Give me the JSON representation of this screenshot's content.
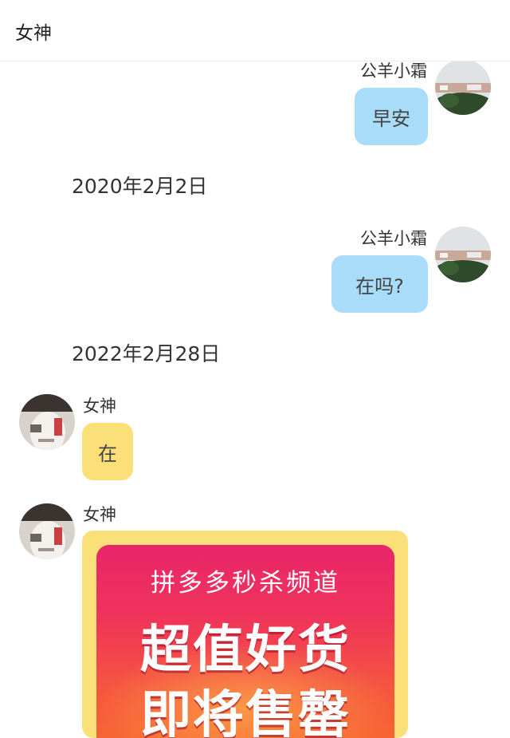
{
  "header": {
    "title": "女神"
  },
  "messages": [
    {
      "sender": "公羊小霜",
      "text": "早安"
    },
    {
      "sender": "公羊小霜",
      "text": "在吗?"
    },
    {
      "sender": "女神",
      "text": "在"
    },
    {
      "sender": "女神"
    }
  ],
  "dates": [
    "2020年2月2日",
    "2022年2月28日"
  ],
  "promo": {
    "subtitle": "拼多多秒杀频道",
    "line1": "超值好货",
    "line2": "即将售罄"
  },
  "colors": {
    "outgoing_bubble": "#a8dcf8",
    "incoming_bubble": "#fbe07a"
  }
}
